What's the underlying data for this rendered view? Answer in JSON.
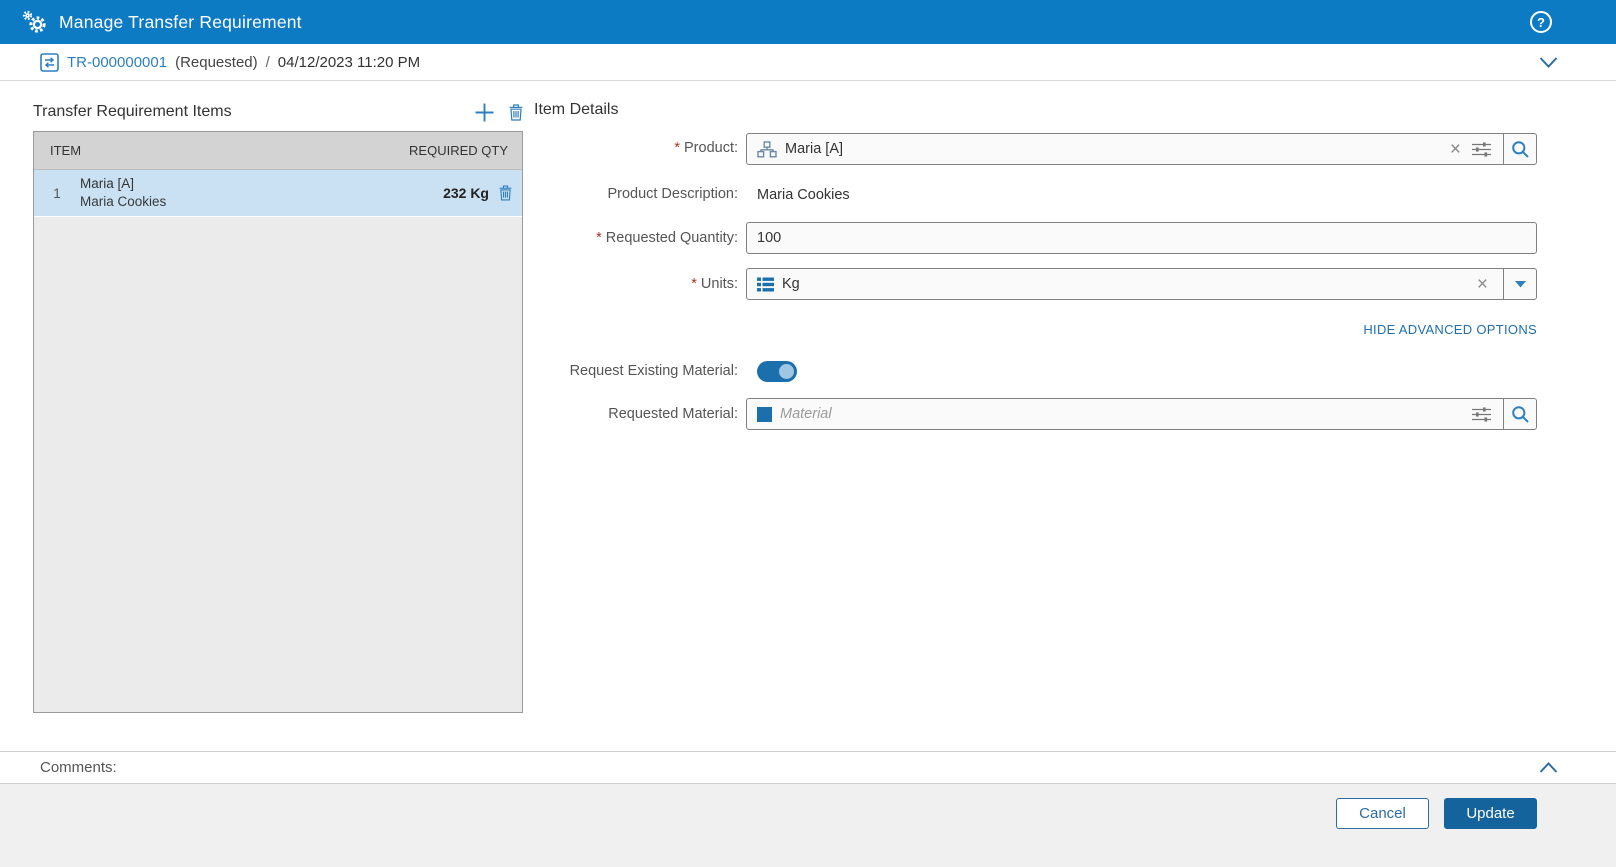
{
  "titlebar": {
    "title": "Manage Transfer Requirement"
  },
  "breadcrumb": {
    "id": "TR-000000001",
    "status": "(Requested)",
    "separator": "/",
    "timestamp": "04/12/2023 11:20 PM"
  },
  "items_panel": {
    "title": "Transfer Requirement Items",
    "columns": {
      "item": "ITEM",
      "required_qty": "REQUIRED QTY"
    },
    "rows": [
      {
        "num": "1",
        "name": "Maria [A]",
        "description": "Maria Cookies",
        "qty": "232 Kg"
      }
    ]
  },
  "item_details": {
    "title": "Item Details",
    "required_marker": "*",
    "product": {
      "label": "Product:",
      "value": "Maria [A]"
    },
    "product_description": {
      "label": "Product Description:",
      "value": "Maria Cookies"
    },
    "requested_quantity": {
      "label": "Requested Quantity:",
      "value": "100"
    },
    "units": {
      "label": "Units:",
      "value": "Kg"
    },
    "advanced_link": "HIDE ADVANCED OPTIONS",
    "request_existing_material": {
      "label": "Request Existing Material:",
      "state": "on"
    },
    "requested_material": {
      "label": "Requested Material:",
      "value": "",
      "placeholder": "Material"
    }
  },
  "comments": {
    "label": "Comments:"
  },
  "footer": {
    "cancel_label": "Cancel",
    "update_label": "Update"
  },
  "glyphs": {
    "clear": "×",
    "help": "?"
  },
  "colors": {
    "header_bg": "#0d7ac4",
    "accent_blue": "#2e7fc0",
    "dark_blue": "#1c6fad",
    "update_button": "#15639c",
    "selected_row": "#cae1f3",
    "table_header_bg": "#d3d3d3",
    "panel_bg": "#ebebeb",
    "required_star": "#a3352b"
  }
}
